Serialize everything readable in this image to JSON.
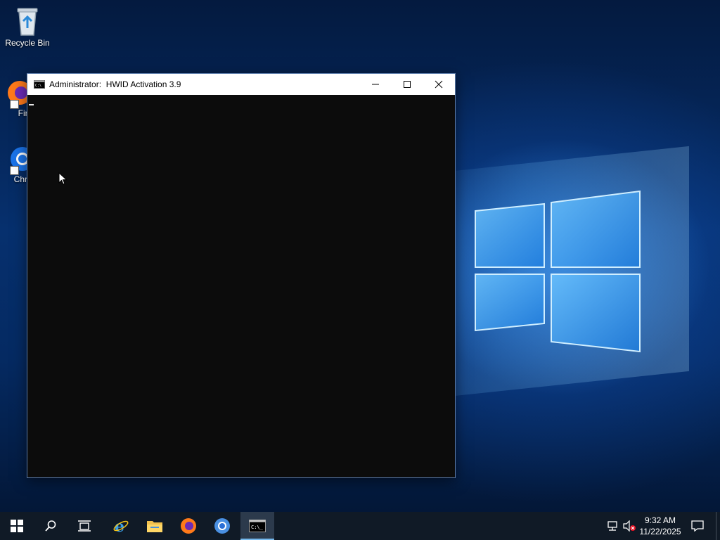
{
  "desktop": {
    "icons": [
      {
        "label": "Recycle Bin",
        "icon": "recycle-bin-icon"
      },
      {
        "label": "Fire",
        "icon": "firefox-icon"
      },
      {
        "label": "Chron",
        "icon": "chrome-icon"
      }
    ]
  },
  "console": {
    "title": "Administrator:  HWID Activation 3.9",
    "icon": "console-icon",
    "minimize_icon": "minimize-icon",
    "maximize_icon": "maximize-icon",
    "close_icon": "close-icon",
    "background": "#0c0c0c"
  },
  "taskbar": {
    "pinned": [
      "start-icon",
      "search-icon",
      "task-view-icon",
      "internet-explorer-icon",
      "file-explorer-icon",
      "firefox-icon",
      "chrome-icon",
      "console-icon"
    ],
    "active": "console-icon",
    "tray": [
      "network-icon",
      "volume-muted-icon",
      "notification-icon"
    ],
    "clock": {
      "time": "9:32 AM",
      "date": "11/22/2025"
    }
  },
  "colors": {
    "taskbar": "#101a26",
    "accent": "#76b9ed",
    "wallpaper": "#06306e"
  }
}
